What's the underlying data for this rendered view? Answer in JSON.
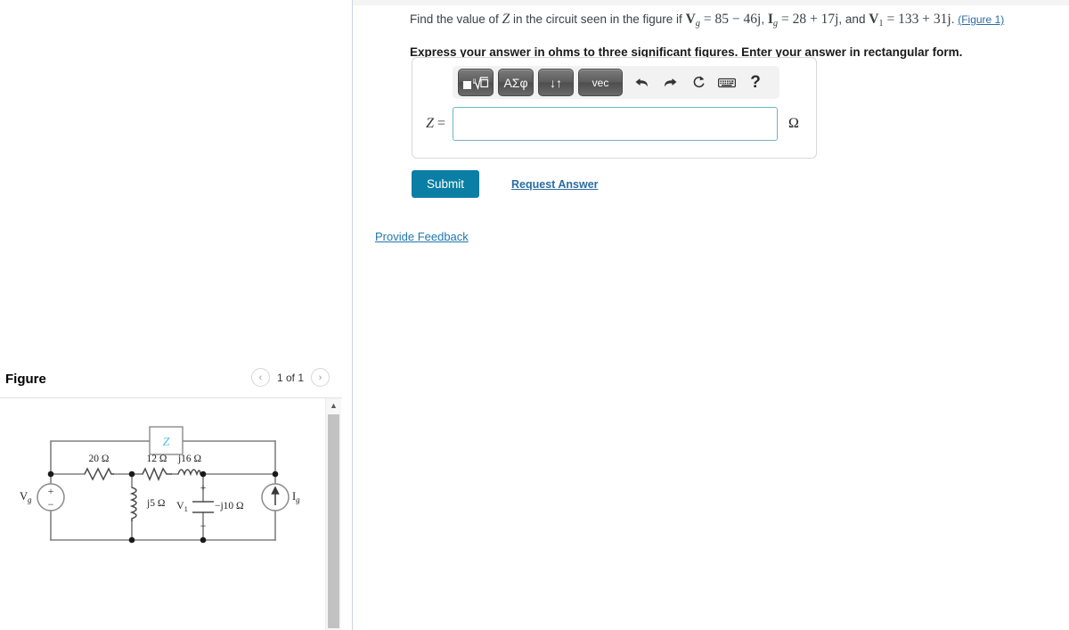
{
  "question": {
    "prefix": "Find the value of ",
    "var_z": "Z",
    "mid": " in the circuit seen in the figure if ",
    "vg_symbol": "V",
    "vg_sub": "g",
    "vg_value": " = 85 − 46j",
    "comma1": ", ",
    "ig_symbol": "I",
    "ig_sub": "g",
    "ig_value": " = 28 + 17j",
    "comma2": ", and ",
    "v1_symbol": "V",
    "v1_sub": "1",
    "v1_value": " = 133 + 31j",
    "period": ". ",
    "figure_link": "(Figure 1)",
    "instruction": "Express your answer in ohms to three significant figures. Enter your answer in rectangular form."
  },
  "answer": {
    "label_var": "Z",
    "label_eq": " =",
    "input_value": "",
    "input_placeholder": "",
    "unit": "Ω"
  },
  "mathbar": {
    "buttons": [
      {
        "name": "template-root-button",
        "label": "■√□"
      },
      {
        "name": "greek-letters-button",
        "label": "ΑΣφ"
      },
      {
        "name": "updown-arrows-button",
        "label": "↓↑"
      },
      {
        "name": "vector-button",
        "label": "vec"
      }
    ],
    "icons": [
      {
        "name": "undo-icon",
        "glyph": "↶"
      },
      {
        "name": "redo-icon",
        "glyph": "↷"
      },
      {
        "name": "reset-icon",
        "glyph": "↺"
      },
      {
        "name": "keyboard-icon",
        "glyph": "⌨"
      },
      {
        "name": "help-icon",
        "glyph": "?"
      }
    ]
  },
  "actions": {
    "submit_label": "Submit",
    "request_answer_label": "Request Answer",
    "provide_feedback_label": "Provide Feedback"
  },
  "figure_panel": {
    "title": "Figure",
    "page_indicator": "1 of 1",
    "prev_glyph": "‹",
    "next_glyph": "›",
    "scroll_up_glyph": "▲"
  },
  "circuit": {
    "z_label": "Z",
    "r1_label": "20 Ω",
    "r2_label": "12 Ω",
    "l_series_label": "j16 Ω",
    "l_shunt_label": "j5 Ω",
    "c_label": "−j10 Ω",
    "v1_label": "V",
    "v1_sub": "1",
    "vg_label": "V",
    "vg_sub": "g",
    "ig_label": "I",
    "ig_sub": "g",
    "plus_sign": "+",
    "minus_sign": "−",
    "z_color": "#4fc3e8",
    "wire_color": "#808080"
  },
  "colors": {
    "accent": "#0a7ea4",
    "link": "#2b6ca3",
    "feedback_link": "#2176ae",
    "input_border": "#71b3c4"
  }
}
